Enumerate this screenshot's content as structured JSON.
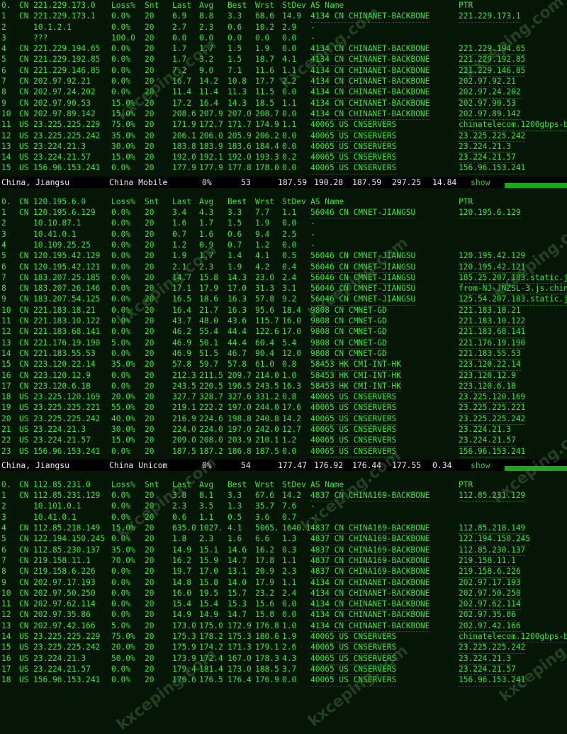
{
  "sections": [
    {
      "header": [
        "0.",
        "CN",
        "221.229.173.0",
        "Loss%",
        "Snt",
        "Last",
        "Avg",
        "Best",
        "Wrst",
        "StDev",
        "AS Name",
        "PTR"
      ],
      "rows": [
        [
          "1",
          "CN",
          "221.229.173.1",
          "0.0%",
          "20",
          "6.9",
          "8.8",
          "3.3",
          "68.6",
          "14.9",
          "4134  CN CHINANET-BACKBONE",
          "221.229.173.1"
        ],
        [
          "2",
          "",
          "10.1.2.1",
          "0.0%",
          "20",
          "2.7",
          "2.3",
          "0.6",
          "10.2",
          "2.9",
          "-",
          ""
        ],
        [
          "3",
          "",
          "???",
          "100.0",
          "20",
          "0.0",
          "0.0",
          "0.0",
          "0.0",
          "0.0",
          "-",
          ""
        ],
        [
          "4",
          "CN",
          "221.229.194.65",
          "0.0%",
          "20",
          "1.7",
          "1.7",
          "1.5",
          "1.9",
          "0.0",
          "4134  CN CHINANET-BACKBONE",
          "221.229.194.65"
        ],
        [
          "5",
          "CN",
          "221.229.192.85",
          "0.0%",
          "20",
          "1.7",
          "3.2",
          "1.5",
          "18.7",
          "4.1",
          "4134  CN CHINANET-BACKBONE",
          "221.229.192.85"
        ],
        [
          "6",
          "CN",
          "221.229.146.85",
          "0.0%",
          "20",
          "7.2",
          "9.0",
          "7.1",
          "11.6",
          "1.1",
          "4134  CN CHINANET-BACKBONE",
          "221.229.146.85"
        ],
        [
          "7",
          "CN",
          "202.97.92.21",
          "0.0%",
          "20",
          "16.7",
          "14.2",
          "10.8",
          "17.7",
          "2.2",
          "4134  CN CHINANET-BACKBONE",
          "202.97.92.21"
        ],
        [
          "8",
          "CN",
          "202.97.24.202",
          "0.0%",
          "20",
          "11.4",
          "11.4",
          "11.3",
          "11.5",
          "0.0",
          "4134  CN CHINANET-BACKBONE",
          "202.97.24.202"
        ],
        [
          "9",
          "CN",
          "202.97.90.53",
          "15.0%",
          "20",
          "17.2",
          "16.4",
          "14.3",
          "18.5",
          "1.1",
          "4134  CN CHINANET-BACKBONE",
          "202.97.90.53"
        ],
        [
          "10",
          "CN",
          "202.97.89.142",
          "15.0%",
          "20",
          "208.6",
          "207.9",
          "207.0",
          "208.7",
          "0.0",
          "4134  CN CHINANET-BACKBONE",
          "202.97.89.142"
        ],
        [
          "11",
          "US",
          "23.225.225.229",
          "75.0%",
          "20",
          "171.9",
          "172.7",
          "171.7",
          "174.9",
          "1.1",
          "40065 US CNSERVERS",
          "chinatelecom.1200gbps-b."
        ],
        [
          "12",
          "US",
          "23.225.225.242",
          "35.0%",
          "20",
          "206.1",
          "206.0",
          "205.9",
          "206.2",
          "0.0",
          "40065 US CNSERVERS",
          "23.225.225.242"
        ],
        [
          "13",
          "US",
          "23.224.21.3",
          "30.0%",
          "20",
          "183.8",
          "183.9",
          "183.6",
          "184.4",
          "0.0",
          "40065 US CNSERVERS",
          "23.224.21.3"
        ],
        [
          "14",
          "US",
          "23.224.21.57",
          "15.0%",
          "20",
          "192.0",
          "192.1",
          "192.0",
          "193.3",
          "0.2",
          "40065 US CNSERVERS",
          "23.224.21.57"
        ],
        [
          "15",
          "US",
          "156.96.153.241",
          "0.0%",
          "20",
          "177.9",
          "177.9",
          "177.8",
          "178.0",
          "0.0",
          "40065 US CNSERVERS",
          "156.96.153.241"
        ]
      ],
      "footer": {
        "location": "China, Jiangsu",
        "isp": "China Mobile",
        "loss": "0%",
        "count": "53",
        "v1": "187.59",
        "v2": "190.28",
        "v3": "187.59",
        "v4": "297.25",
        "v5": "14.84",
        "action": "show"
      }
    },
    {
      "header": [
        "0.",
        "CN",
        "120.195.6.0",
        "Loss%",
        "Snt",
        "Last",
        "Avg",
        "Best",
        "Wrst",
        "StDev",
        "AS Name",
        "PTR"
      ],
      "rows": [
        [
          "1",
          "CN",
          "120.195.6.129",
          "0.0%",
          "20",
          "3.4",
          "4.3",
          "3.3",
          "7.7",
          "1.1",
          "56046 CN CMNET-JIANGSU",
          "120.195.6.129"
        ],
        [
          "2",
          "",
          "10.10.87.1",
          "0.0%",
          "20",
          "1.6",
          "1.7",
          "1.5",
          "1.9",
          "0.0",
          "-",
          ""
        ],
        [
          "3",
          "",
          "10.41.0.1",
          "0.0%",
          "20",
          "0.7",
          "1.6",
          "0.6",
          "9.4",
          "2.5",
          "-",
          ""
        ],
        [
          "4",
          "",
          "10.109.25.25",
          "0.0%",
          "20",
          "1.2",
          "0.9",
          "0.7",
          "1.2",
          "0.0",
          "-",
          ""
        ],
        [
          "5",
          "CN",
          "120.195.42.129",
          "0.0%",
          "20",
          "1.9",
          "1.7",
          "1.4",
          "4.1",
          "0.5",
          "56046 CN CMNET-JIANGSU",
          "120.195.42.129"
        ],
        [
          "6",
          "CN",
          "120.195.42.121",
          "0.0%",
          "20",
          "2.1",
          "2.3",
          "1.9",
          "4.2",
          "0.4",
          "56046 CN CMNET-JIANGSU",
          "120.195.42.121"
        ],
        [
          "7",
          "CN",
          "183.207.25.185",
          "0.0%",
          "20",
          "14.7",
          "15.8",
          "14.3",
          "23.0",
          "2.4",
          "56046 CN CMNET-JIANGSU",
          "185.25.207.183.static.js"
        ],
        [
          "8",
          "CN",
          "183.207.26.146",
          "0.0%",
          "20",
          "17.1",
          "17.9",
          "17.0",
          "31.3",
          "3.1",
          "56046 CN CMNET-JIANGSU",
          "from-NJ-JNZSL-3.js.china"
        ],
        [
          "9",
          "CN",
          "183.207.54.125",
          "0.0%",
          "20",
          "16.5",
          "18.6",
          "16.3",
          "57.8",
          "9.2",
          "56046 CN CMNET-JIANGSU",
          "125.54.207.183.static.js"
        ],
        [
          "10",
          "CN",
          "221.183.18.21",
          "0.0%",
          "20",
          "16.4",
          "21.7",
          "16.3",
          "95.6",
          "18.4",
          "9808  CN CMNET-GD",
          "221.183.18.21"
        ],
        [
          "11",
          "CN",
          "221.183.10.122",
          "0.0%",
          "20",
          "43.7",
          "48.0",
          "43.6",
          "115.7",
          "16.0",
          "9808  CN CMNET-GD",
          "221.183.10.122"
        ],
        [
          "12",
          "CN",
          "221.183.68.141",
          "0.0%",
          "20",
          "46.2",
          "55.4",
          "44.4",
          "122.6",
          "17.0",
          "9808  CN CMNET-GD",
          "221.183.68.141"
        ],
        [
          "13",
          "CN",
          "221.176.19.190",
          "5.0%",
          "20",
          "46.9",
          "50.1",
          "44.4",
          "60.4",
          "5.4",
          "9808  CN CMNET-GD",
          "221.176.19.190"
        ],
        [
          "14",
          "CN",
          "221.183.55.53",
          "0.0%",
          "20",
          "46.9",
          "51.5",
          "46.7",
          "90.4",
          "12.0",
          "9808  CN CMNET-GD",
          "221.183.55.53"
        ],
        [
          "15",
          "CN",
          "223.120.22.14",
          "35.0%",
          "20",
          "57.8",
          "59.7",
          "57.8",
          "61.0",
          "0.8",
          "58453 HK CMI-INT-HK",
          "223.120.22.14"
        ],
        [
          "16",
          "CN",
          "223.120.12.9",
          "0.0%",
          "20",
          "212.3",
          "211.5",
          "209.7",
          "214.0",
          "1.0",
          "58453 HK CMI-INT-HK",
          "223.120.12.9"
        ],
        [
          "17",
          "CN",
          "223.120.6.18",
          "0.0%",
          "20",
          "243.5",
          "220.5",
          "196.5",
          "243.5",
          "16.3",
          "58453 HK CMI-INT-HK",
          "223.120.6.18"
        ],
        [
          "18",
          "US",
          "23.225.120.169",
          "20.0%",
          "20",
          "327.7",
          "328.7",
          "327.6",
          "331.2",
          "0.8",
          "40065 US CNSERVERS",
          "23.225.120.169"
        ],
        [
          "19",
          "US",
          "23.225.225.221",
          "55.0%",
          "20",
          "219.1",
          "222.2",
          "197.0",
          "244.0",
          "17.6",
          "40065 US CNSERVERS",
          "23.225.225.221"
        ],
        [
          "20",
          "US",
          "23.225.225.242",
          "40.0%",
          "20",
          "216.9",
          "224.6",
          "198.8",
          "240.8",
          "14.2",
          "40065 US CNSERVERS",
          "23.225.225.242"
        ],
        [
          "21",
          "US",
          "23.224.21.3",
          "30.0%",
          "20",
          "224.0",
          "224.0",
          "197.0",
          "242.0",
          "12.7",
          "40065 US CNSERVERS",
          "23.224.21.3"
        ],
        [
          "22",
          "US",
          "23.224.21.57",
          "15.0%",
          "20",
          "209.0",
          "208.0",
          "203.9",
          "210.1",
          "1.2",
          "40065 US CNSERVERS",
          "23.224.21.57"
        ],
        [
          "23",
          "US",
          "156.96.153.241",
          "0.0%",
          "20",
          "187.5",
          "187.2",
          "186.8",
          "187.5",
          "0.0",
          "40065 US CNSERVERS",
          "156.96.153.241"
        ]
      ],
      "footer": {
        "location": "China, Jiangsu",
        "isp": "China Unicom",
        "loss": "0%",
        "count": "54",
        "v1": "177.47",
        "v2": "176.92",
        "v3": "176.44",
        "v4": "177.55",
        "v5": "0.34",
        "action": "show"
      }
    },
    {
      "header": [
        "0.",
        "CN",
        "112.85.231.0",
        "Loss%",
        "Snt",
        "Last",
        "Avg",
        "Best",
        "Wrst",
        "StDev",
        "AS Name",
        "PTR"
      ],
      "rows": [
        [
          "1",
          "CN",
          "112.85.231.129",
          "0.0%",
          "20",
          "3.8",
          "8.1",
          "3.3",
          "67.6",
          "14.2",
          "4837  CN CHINA169-BACKBONE",
          "112.85.231.129"
        ],
        [
          "2",
          "",
          "10.101.0.1",
          "0.0%",
          "20",
          "2.3",
          "3.5",
          "1.3",
          "35.7",
          "7.6",
          "-",
          ""
        ],
        [
          "3",
          "",
          "10.41.0.1",
          "0.0%",
          "20",
          "0.6",
          "1.1",
          "0.5",
          "3.6",
          "0.7",
          "-",
          ""
        ],
        [
          "4",
          "CN",
          "112.85.218.149",
          "15.0%",
          "20",
          "635.0",
          "1027.",
          "4.1",
          "5065.",
          "1640.1",
          "4837  CN CHINA169-BACKBONE",
          "112.85.218.149"
        ],
        [
          "5",
          "CN",
          "122.194.150.245",
          "0.0%",
          "20",
          "1.8",
          "2.3",
          "1.6",
          "6.6",
          "1.3",
          "4837  CN CHINA169-BACKBONE",
          "122.194.150.245"
        ],
        [
          "6",
          "CN",
          "112.85.230.137",
          "35.0%",
          "20",
          "14.9",
          "15.1",
          "14.6",
          "16.2",
          "0.3",
          "4837  CN CHINA169-BACKBONE",
          "112.85.230.137"
        ],
        [
          "7",
          "CN",
          "219.158.11.1",
          "70.0%",
          "20",
          "16.2",
          "15.9",
          "14.7",
          "17.8",
          "1.1",
          "4837  CN CHINA169-BACKBONE",
          "219.158.11.1"
        ],
        [
          "8",
          "CN",
          "219.158.6.226",
          "0.0%",
          "20",
          "19.7",
          "17.0",
          "13.1",
          "20.9",
          "2.3",
          "4837  CN CHINA169-BACKBONE",
          "219.158.6.226"
        ],
        [
          "9",
          "CN",
          "202.97.17.193",
          "0.0%",
          "20",
          "14.8",
          "15.8",
          "14.0",
          "17.9",
          "1.1",
          "4134  CN CHINANET-BACKBONE",
          "202.97.17.193"
        ],
        [
          "10",
          "CN",
          "202.97.50.250",
          "0.0%",
          "20",
          "16.0",
          "19.5",
          "15.7",
          "23.2",
          "2.4",
          "4134  CN CHINANET-BACKBONE",
          "202.97.50.250"
        ],
        [
          "11",
          "CN",
          "202.97.62.114",
          "0.0%",
          "20",
          "15.4",
          "15.4",
          "15.3",
          "15.6",
          "0.0",
          "4134  CN CHINANET-BACKBONE",
          "202.97.62.114"
        ],
        [
          "12",
          "CN",
          "202.97.35.86",
          "0.0%",
          "20",
          "14.9",
          "14.9",
          "14.7",
          "15.8",
          "0.0",
          "4134  CN CHINANET-BACKBONE",
          "202.97.35.86"
        ],
        [
          "13",
          "CN",
          "202.97.42.166",
          "5.0%",
          "20",
          "173.0",
          "175.0",
          "172.9",
          "176.8",
          "1.0",
          "4134  CN CHINANET-BACKBONE",
          "202.97.42.166"
        ],
        [
          "14",
          "US",
          "23.225.225.229",
          "75.0%",
          "20",
          "175.3",
          "178.2",
          "175.3",
          "180.6",
          "1.9",
          "40065 US CNSERVERS",
          "chinatelecom.1200gbps-b."
        ],
        [
          "15",
          "US",
          "23.225.225.242",
          "20.0%",
          "20",
          "175.9",
          "174.2",
          "171.3",
          "179.1",
          "2.6",
          "40065 US CNSERVERS",
          "23.225.225.242"
        ],
        [
          "16",
          "US",
          "23.224.21.3",
          "50.0%",
          "20",
          "173.9",
          "172.4",
          "167.0",
          "178.3",
          "4.3",
          "40065 US CNSERVERS",
          "23.224.21.3"
        ],
        [
          "17",
          "US",
          "23.224.21.57",
          "0.0%",
          "20",
          "179.4",
          "181.4",
          "173.0",
          "188.5",
          "3.7",
          "40065 US CNSERVERS",
          "23.224.21.57"
        ],
        [
          "18",
          "US",
          "156.96.153.241",
          "0.0%",
          "20",
          "176.6",
          "176.5",
          "176.4",
          "176.9",
          "0.0",
          "40065 US CNSERVERS",
          "156.96.153.241"
        ]
      ]
    }
  ],
  "watermark": "kxceping.com"
}
